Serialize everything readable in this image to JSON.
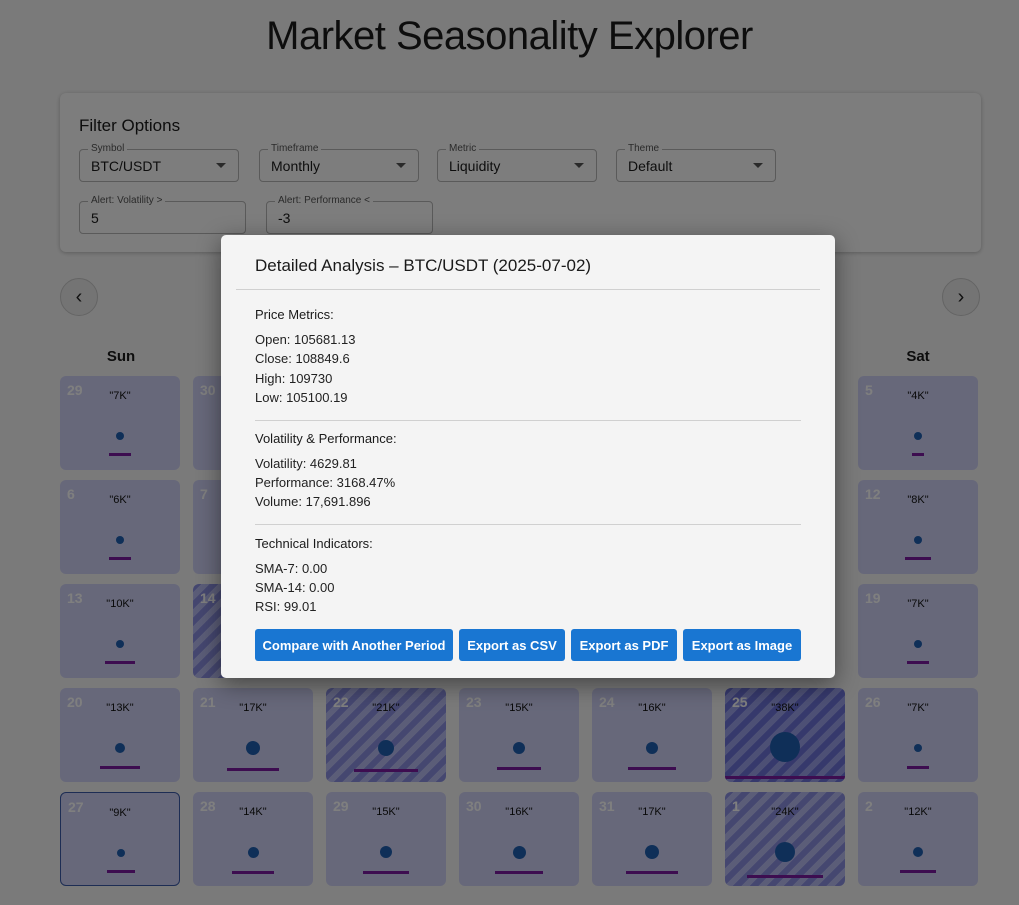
{
  "page": {
    "title": "Market Seasonality Explorer"
  },
  "filters": {
    "title": "Filter Options",
    "symbol": {
      "label": "Symbol",
      "value": "BTC/USDT"
    },
    "timeframe": {
      "label": "Timeframe",
      "value": "Monthly"
    },
    "metric": {
      "label": "Metric",
      "value": "Liquidity"
    },
    "theme": {
      "label": "Theme",
      "value": "Default"
    },
    "alert_volatility": {
      "label": "Alert: Volatility >",
      "value": "5"
    },
    "alert_performance": {
      "label": "Alert: Performance <",
      "value": "-3"
    }
  },
  "nav": {
    "prev_icon": "‹",
    "next_icon": "›"
  },
  "weekdays": {
    "sun": "Sun",
    "sat": "Sat"
  },
  "calendar": {
    "cells": [
      {
        "day": "29",
        "value": "\"7K\""
      },
      {
        "day": "30",
        "value": ""
      },
      {
        "day": "5",
        "value": "\"4K\""
      },
      {
        "day": "6",
        "value": "\"6K\""
      },
      {
        "day": "7",
        "value": ""
      },
      {
        "day": "12",
        "value": "\"8K\""
      },
      {
        "day": "13",
        "value": "\"10K\""
      },
      {
        "day": "14",
        "value": ""
      },
      {
        "day": "19",
        "value": "\"7K\""
      },
      {
        "day": "20",
        "value": "\"13K\""
      },
      {
        "day": "21",
        "value": "\"17K\""
      },
      {
        "day": "22",
        "value": "\"21K\""
      },
      {
        "day": "23",
        "value": "\"15K\""
      },
      {
        "day": "24",
        "value": "\"16K\""
      },
      {
        "day": "25",
        "value": "\"38K\""
      },
      {
        "day": "26",
        "value": "\"7K\""
      },
      {
        "day": "27",
        "value": "\"9K\""
      },
      {
        "day": "28",
        "value": "\"14K\""
      },
      {
        "day": "29",
        "value": "\"15K\""
      },
      {
        "day": "30",
        "value": "\"16K\""
      },
      {
        "day": "31",
        "value": "\"17K\""
      },
      {
        "day": "1",
        "value": "\"24K\""
      },
      {
        "day": "2",
        "value": "\"12K\""
      }
    ]
  },
  "modal": {
    "title": "Detailed Analysis – BTC/USDT (2025-07-02)",
    "price_header": "Price Metrics:",
    "open": "Open: 105681.13",
    "close": "Close: 108849.6",
    "high": "High: 109730",
    "low": "Low: 105100.19",
    "vol_header": "Volatility & Performance:",
    "volatility": "Volatility: 4629.81",
    "performance": "Performance: 3168.47%",
    "volume": "Volume: 17,691.896",
    "tech_header": "Technical Indicators:",
    "sma7": "SMA-7: 0.00",
    "sma14": "SMA-14: 0.00",
    "rsi": "RSI: 99.01",
    "buttons": {
      "compare": "Compare with Another Period",
      "csv": "Export as CSV",
      "pdf": "Export as PDF",
      "image": "Export as Image"
    }
  },
  "colors": {
    "accent": "#1976d2",
    "overlay": "rgba(0,0,0,0.5)",
    "cell": "#cfd1f4",
    "dot": "#1f5fb0",
    "bar": "#7a1aa0"
  }
}
